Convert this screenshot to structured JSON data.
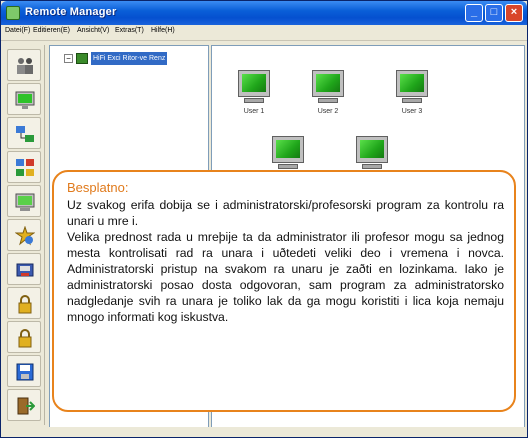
{
  "window": {
    "title": "Remote Manager"
  },
  "menubar": {
    "items": [
      "Datei(F)",
      "Editieren(E)",
      "Ansicht(V)",
      "Extras(T)",
      "Hilfe(H)"
    ]
  },
  "toolbar": {
    "icons": [
      "users-icon",
      "monitor-icon",
      "network-icon",
      "computers-grid-icon",
      "screen-green-icon",
      "star-settings-icon",
      "disk-icon",
      "lock-icon",
      "lock-icon",
      "save-icon",
      "exit-icon"
    ]
  },
  "tree": {
    "root_label": "HiFi Exci Ritor-ve Renz"
  },
  "computers": [
    {
      "label": "User 1"
    },
    {
      "label": "User 2"
    },
    {
      "label": "User 3"
    },
    {
      "label": ""
    },
    {
      "label": ""
    }
  ],
  "callout": {
    "heading": "Besplatno:",
    "body": "Uz svakog   erifa dobija se i administratorski/profesorski program za kontrolu ra  unari u mre i.\nVelika prednost rada u mreþije ta da administrator ili profesor mogu sa jednog mesta kontrolisati rad ra unara i uðtedeti veliki deo i vremena i novca. Administratorski pristup na svakom ra unaru je zaðti en lozinkama. Iako je administratorski posao dosta odgovoran, sam program za administratorsko nadgledanje svih ra unara je toliko lak da ga mogu koristiti i lica koja nemaju mnogo informati kog iskustva."
  },
  "colors": {
    "accent": "#e8831c",
    "titlebar": "#0a5fd8",
    "selection": "#316ac5"
  }
}
